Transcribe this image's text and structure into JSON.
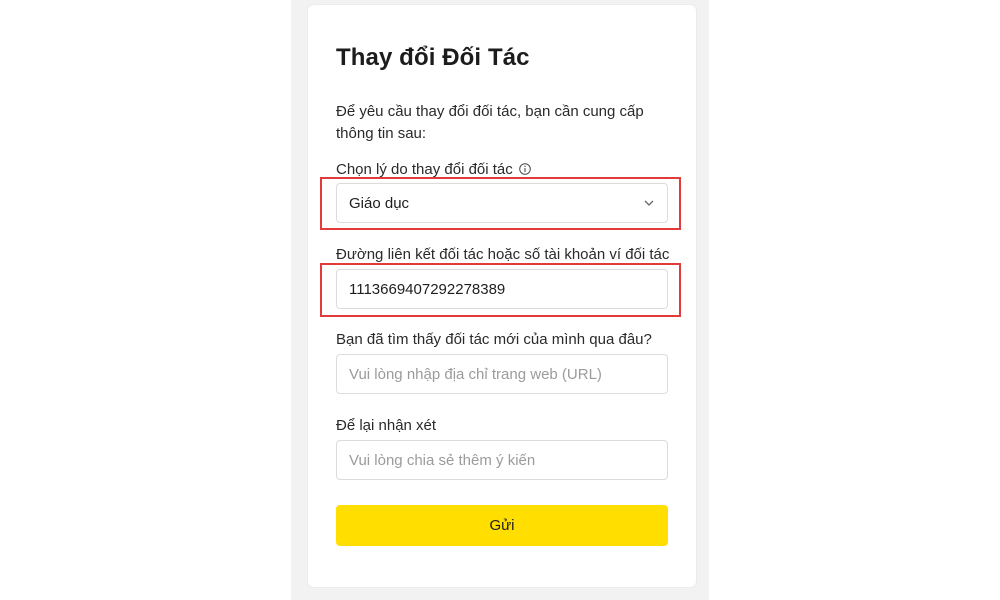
{
  "form": {
    "title": "Thay đổi Đối Tác",
    "intro": "Để yêu cầu thay đổi đối tác, bạn cần cung cấp thông tin sau:",
    "reason": {
      "label": "Chọn lý do thay đổi đối tác",
      "selected": "Giáo dục",
      "icon": "chevron-down-icon",
      "info_icon": "info-icon"
    },
    "partner_link": {
      "label": "Đường liên kết đối tác hoặc số tài khoản ví đối tác",
      "value": "1113669407292278389"
    },
    "found_where": {
      "label": "Bạn đã tìm thấy đối tác mới của mình qua đâu?",
      "placeholder": "Vui lòng nhập địa chỉ trang web (URL)"
    },
    "comment": {
      "label": "Để lại nhận xét",
      "placeholder": "Vui lòng chia sẻ thêm ý kiến"
    },
    "submit_label": "Gửi"
  },
  "colors": {
    "accent": "#ffde00",
    "highlight": "#e23b3b",
    "background": "#f2f2f3"
  }
}
